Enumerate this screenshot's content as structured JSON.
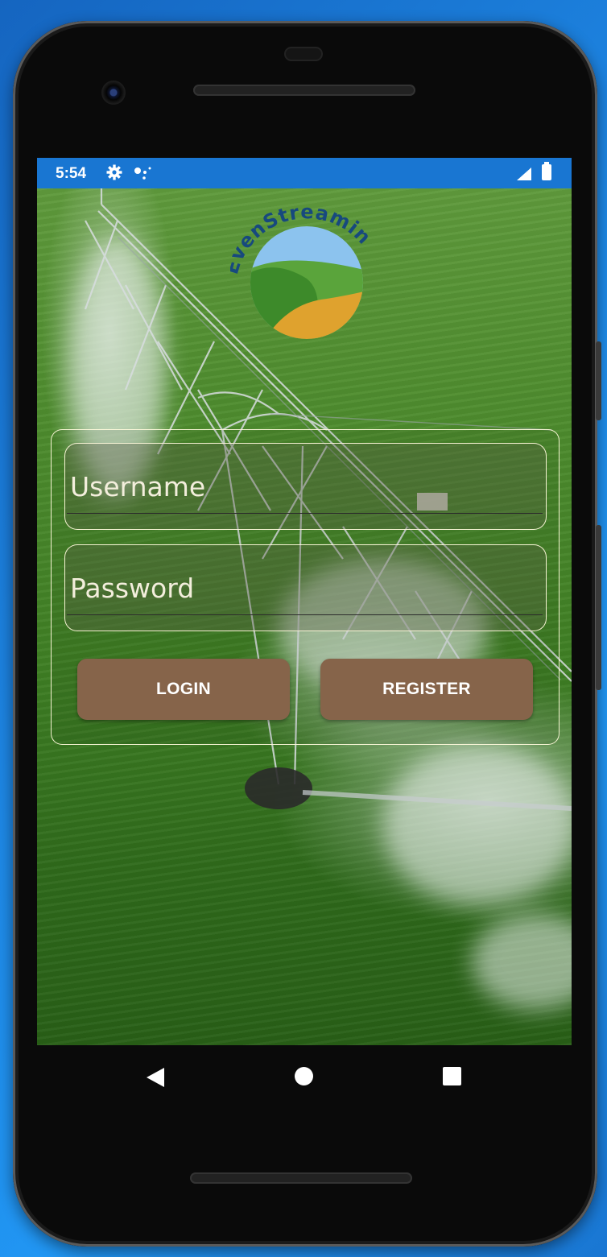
{
  "status_bar": {
    "time": "5:54",
    "icons": [
      "settings-icon",
      "notification-dots-icon",
      "cell-signal-icon",
      "battery-icon"
    ],
    "color": "#1976d2"
  },
  "logo": {
    "text": "EvenStreamin",
    "colors": {
      "text": "#17497e",
      "sky": "#8cc3ee",
      "hill_light": "#5aa43b",
      "hill_dark": "#3d8a2a",
      "field": "#dfa22e"
    }
  },
  "login_form": {
    "username": {
      "placeholder": "Username",
      "value": ""
    },
    "password": {
      "placeholder": "Password",
      "value": ""
    },
    "login_label": "LOGIN",
    "register_label": "REGISTER",
    "button_color": "#86644a"
  },
  "navigation": {
    "icons": [
      "back-icon",
      "home-icon",
      "recents-icon"
    ]
  }
}
